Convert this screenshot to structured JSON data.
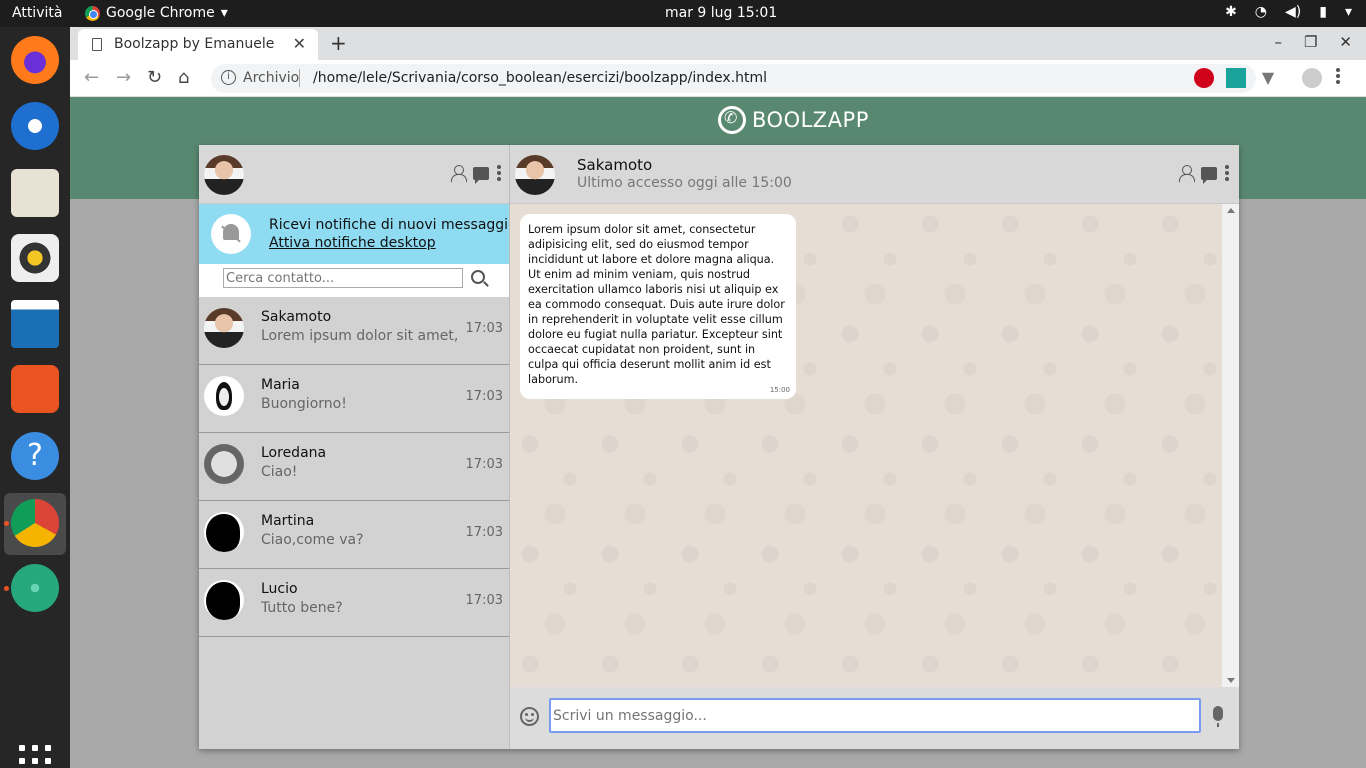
{
  "system": {
    "activities": "Attività",
    "app_name": "Google Chrome",
    "clock": "mar 9 lug  15:01"
  },
  "browser": {
    "tab_title": "Boolzapp by Emanuele",
    "scheme_label": "Archivio",
    "url": "/home/lele/Scrivania/corso_boolean/esercizi/boolzapp/index.html"
  },
  "page": {
    "brand": "BOOLZAPP",
    "notification": {
      "title": "Ricevi notifiche di nuovi messaggi",
      "link": "Attiva notifiche desktop"
    },
    "search_placeholder": "Cerca contatto...",
    "contacts": [
      {
        "name": "Sakamoto",
        "last_message": "Lorem ipsum dolor sit amet,",
        "time": "17:03",
        "avatar": "person-photo"
      },
      {
        "name": "Maria",
        "last_message": "Buongiorno!",
        "time": "17:03",
        "avatar": "ghost-mask"
      },
      {
        "name": "Loredana",
        "last_message": "Ciao!",
        "time": "17:03",
        "avatar": "baby-face"
      },
      {
        "name": "Martina",
        "last_message": "Ciao,come va?",
        "time": "17:03",
        "avatar": "silhouette"
      },
      {
        "name": "Lucio",
        "last_message": "Tutto bene?",
        "time": "17:03",
        "avatar": "silhouette"
      }
    ],
    "chat": {
      "contact_name": "Sakamoto",
      "last_seen": "Ultimo accesso oggi alle 15:00",
      "messages": [
        {
          "text": "Lorem ipsum dolor sit amet, consectetur adipisicing elit, sed do eiusmod tempor incididunt ut labore et dolore magna aliqua. Ut enim ad minim veniam, quis nostrud exercitation ullamco laboris nisi ut aliquip ex ea commodo consequat. Duis aute irure dolor in reprehenderit in voluptate velit esse cillum dolore eu fugiat nulla pariatur. Excepteur sint occaecat cupidatat non proident, sunt in culpa qui officia deserunt mollit anim id est laborum.",
          "time": "15:00"
        }
      ]
    },
    "compose_placeholder": "Scrivi un messaggio..."
  },
  "colors": {
    "header_green": "#588870",
    "notify_blue": "#8edbf2",
    "chat_bg": "#e6ded5"
  }
}
